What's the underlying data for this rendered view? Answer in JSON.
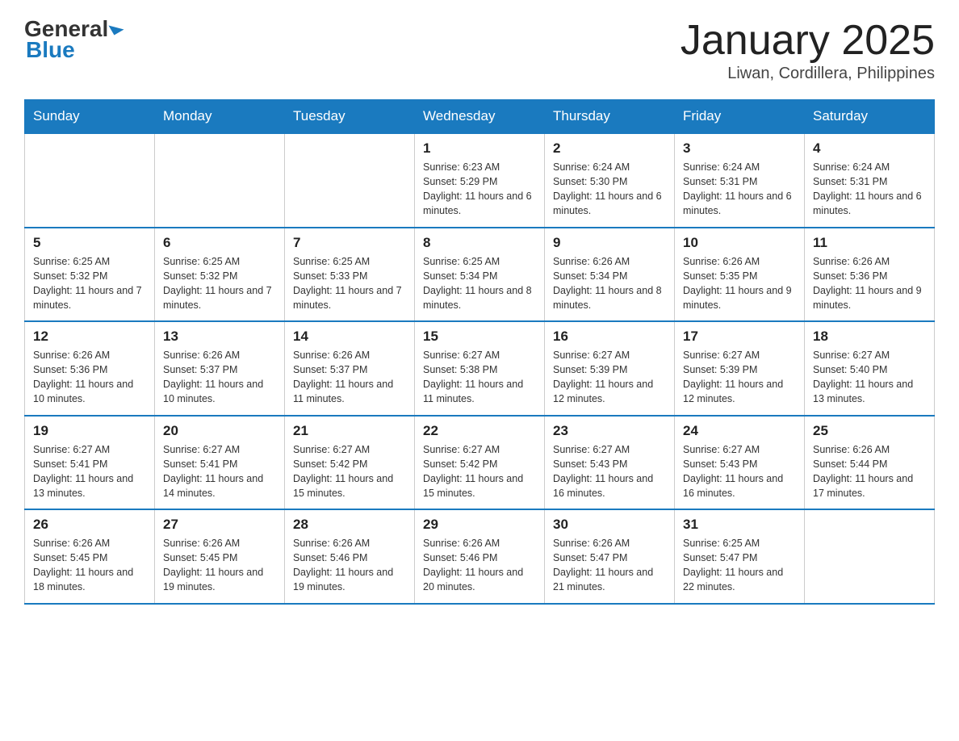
{
  "logo": {
    "general": "General",
    "blue": "Blue"
  },
  "header": {
    "title": "January 2025",
    "location": "Liwan, Cordillera, Philippines"
  },
  "days_of_week": [
    "Sunday",
    "Monday",
    "Tuesday",
    "Wednesday",
    "Thursday",
    "Friday",
    "Saturday"
  ],
  "weeks": [
    {
      "days": [
        {
          "num": "",
          "info": ""
        },
        {
          "num": "",
          "info": ""
        },
        {
          "num": "",
          "info": ""
        },
        {
          "num": "1",
          "info": "Sunrise: 6:23 AM\nSunset: 5:29 PM\nDaylight: 11 hours and 6 minutes."
        },
        {
          "num": "2",
          "info": "Sunrise: 6:24 AM\nSunset: 5:30 PM\nDaylight: 11 hours and 6 minutes."
        },
        {
          "num": "3",
          "info": "Sunrise: 6:24 AM\nSunset: 5:31 PM\nDaylight: 11 hours and 6 minutes."
        },
        {
          "num": "4",
          "info": "Sunrise: 6:24 AM\nSunset: 5:31 PM\nDaylight: 11 hours and 6 minutes."
        }
      ]
    },
    {
      "days": [
        {
          "num": "5",
          "info": "Sunrise: 6:25 AM\nSunset: 5:32 PM\nDaylight: 11 hours and 7 minutes."
        },
        {
          "num": "6",
          "info": "Sunrise: 6:25 AM\nSunset: 5:32 PM\nDaylight: 11 hours and 7 minutes."
        },
        {
          "num": "7",
          "info": "Sunrise: 6:25 AM\nSunset: 5:33 PM\nDaylight: 11 hours and 7 minutes."
        },
        {
          "num": "8",
          "info": "Sunrise: 6:25 AM\nSunset: 5:34 PM\nDaylight: 11 hours and 8 minutes."
        },
        {
          "num": "9",
          "info": "Sunrise: 6:26 AM\nSunset: 5:34 PM\nDaylight: 11 hours and 8 minutes."
        },
        {
          "num": "10",
          "info": "Sunrise: 6:26 AM\nSunset: 5:35 PM\nDaylight: 11 hours and 9 minutes."
        },
        {
          "num": "11",
          "info": "Sunrise: 6:26 AM\nSunset: 5:36 PM\nDaylight: 11 hours and 9 minutes."
        }
      ]
    },
    {
      "days": [
        {
          "num": "12",
          "info": "Sunrise: 6:26 AM\nSunset: 5:36 PM\nDaylight: 11 hours and 10 minutes."
        },
        {
          "num": "13",
          "info": "Sunrise: 6:26 AM\nSunset: 5:37 PM\nDaylight: 11 hours and 10 minutes."
        },
        {
          "num": "14",
          "info": "Sunrise: 6:26 AM\nSunset: 5:37 PM\nDaylight: 11 hours and 11 minutes."
        },
        {
          "num": "15",
          "info": "Sunrise: 6:27 AM\nSunset: 5:38 PM\nDaylight: 11 hours and 11 minutes."
        },
        {
          "num": "16",
          "info": "Sunrise: 6:27 AM\nSunset: 5:39 PM\nDaylight: 11 hours and 12 minutes."
        },
        {
          "num": "17",
          "info": "Sunrise: 6:27 AM\nSunset: 5:39 PM\nDaylight: 11 hours and 12 minutes."
        },
        {
          "num": "18",
          "info": "Sunrise: 6:27 AM\nSunset: 5:40 PM\nDaylight: 11 hours and 13 minutes."
        }
      ]
    },
    {
      "days": [
        {
          "num": "19",
          "info": "Sunrise: 6:27 AM\nSunset: 5:41 PM\nDaylight: 11 hours and 13 minutes."
        },
        {
          "num": "20",
          "info": "Sunrise: 6:27 AM\nSunset: 5:41 PM\nDaylight: 11 hours and 14 minutes."
        },
        {
          "num": "21",
          "info": "Sunrise: 6:27 AM\nSunset: 5:42 PM\nDaylight: 11 hours and 15 minutes."
        },
        {
          "num": "22",
          "info": "Sunrise: 6:27 AM\nSunset: 5:42 PM\nDaylight: 11 hours and 15 minutes."
        },
        {
          "num": "23",
          "info": "Sunrise: 6:27 AM\nSunset: 5:43 PM\nDaylight: 11 hours and 16 minutes."
        },
        {
          "num": "24",
          "info": "Sunrise: 6:27 AM\nSunset: 5:43 PM\nDaylight: 11 hours and 16 minutes."
        },
        {
          "num": "25",
          "info": "Sunrise: 6:26 AM\nSunset: 5:44 PM\nDaylight: 11 hours and 17 minutes."
        }
      ]
    },
    {
      "days": [
        {
          "num": "26",
          "info": "Sunrise: 6:26 AM\nSunset: 5:45 PM\nDaylight: 11 hours and 18 minutes."
        },
        {
          "num": "27",
          "info": "Sunrise: 6:26 AM\nSunset: 5:45 PM\nDaylight: 11 hours and 19 minutes."
        },
        {
          "num": "28",
          "info": "Sunrise: 6:26 AM\nSunset: 5:46 PM\nDaylight: 11 hours and 19 minutes."
        },
        {
          "num": "29",
          "info": "Sunrise: 6:26 AM\nSunset: 5:46 PM\nDaylight: 11 hours and 20 minutes."
        },
        {
          "num": "30",
          "info": "Sunrise: 6:26 AM\nSunset: 5:47 PM\nDaylight: 11 hours and 21 minutes."
        },
        {
          "num": "31",
          "info": "Sunrise: 6:25 AM\nSunset: 5:47 PM\nDaylight: 11 hours and 22 minutes."
        },
        {
          "num": "",
          "info": ""
        }
      ]
    }
  ]
}
